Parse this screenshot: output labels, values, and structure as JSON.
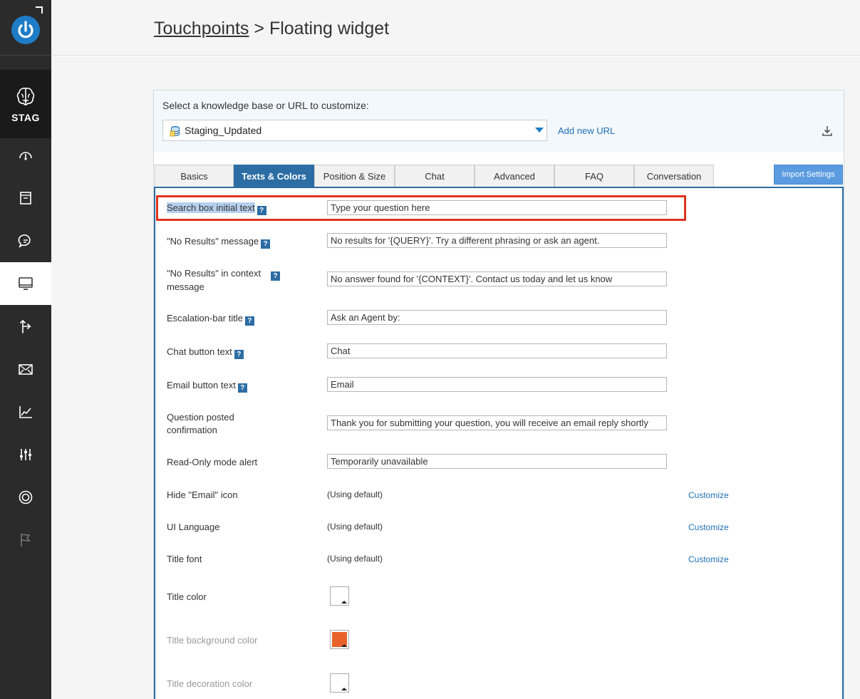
{
  "sidebar": {
    "workspace_label": "STAG"
  },
  "header": {
    "breadcrumb_link": "Touchpoints",
    "breadcrumb_sep": " > ",
    "breadcrumb_current": "Floating widget"
  },
  "kb": {
    "select_label": "Select a knowledge base or URL to customize:",
    "selected": "Staging_Updated",
    "add_url": "Add new URL"
  },
  "tabs": [
    {
      "label": "Basics"
    },
    {
      "label": "Texts & Colors"
    },
    {
      "label": "Position & Size"
    },
    {
      "label": "Chat"
    },
    {
      "label": "Advanced"
    },
    {
      "label": "FAQ"
    },
    {
      "label": "Conversation"
    }
  ],
  "import_settings": "Import Settings",
  "fields": {
    "search_box": {
      "label": "Search box initial text",
      "value": "Type your question here"
    },
    "no_results": {
      "label": "\"No Results\" message",
      "value": "No results for '{QUERY}'. Try a different phrasing or ask an agent."
    },
    "no_results_ctx": {
      "label_1": "\"No Results\" in context",
      "label_2": "message",
      "value": "No answer found for '{CONTEXT}'. Contact us today and let us know"
    },
    "escalation": {
      "label": "Escalation-bar title",
      "value": "Ask an Agent by:"
    },
    "chat_btn": {
      "label": "Chat button text",
      "value": "Chat"
    },
    "email_btn": {
      "label": "Email button text",
      "value": "Email"
    },
    "question_posted": {
      "label_1": "Question posted",
      "label_2": "confirmation",
      "value": "Thank you for submitting your question, you will receive an email reply shortly"
    },
    "readonly": {
      "label": "Read-Only mode alert",
      "value": "Temporarily unavailable"
    },
    "hide_email": {
      "label": "Hide \"Email\" icon",
      "value": "(Using default)",
      "action": "Customize"
    },
    "ui_lang": {
      "label": "UI Language",
      "value": "(Using default)",
      "action": "Customize"
    },
    "title_font": {
      "label": "Title font",
      "value": "(Using default)",
      "action": "Customize"
    },
    "title_color": {
      "label": "Title color",
      "color": "#ffffff"
    },
    "title_bg": {
      "label": "Title background color",
      "color": "#e8622a"
    },
    "title_deco": {
      "label": "Title decoration color",
      "color": "#ffffff"
    }
  },
  "help_glyph": "?",
  "colors": {
    "accent": "#2c6da4",
    "highlight": "#e0341e"
  }
}
